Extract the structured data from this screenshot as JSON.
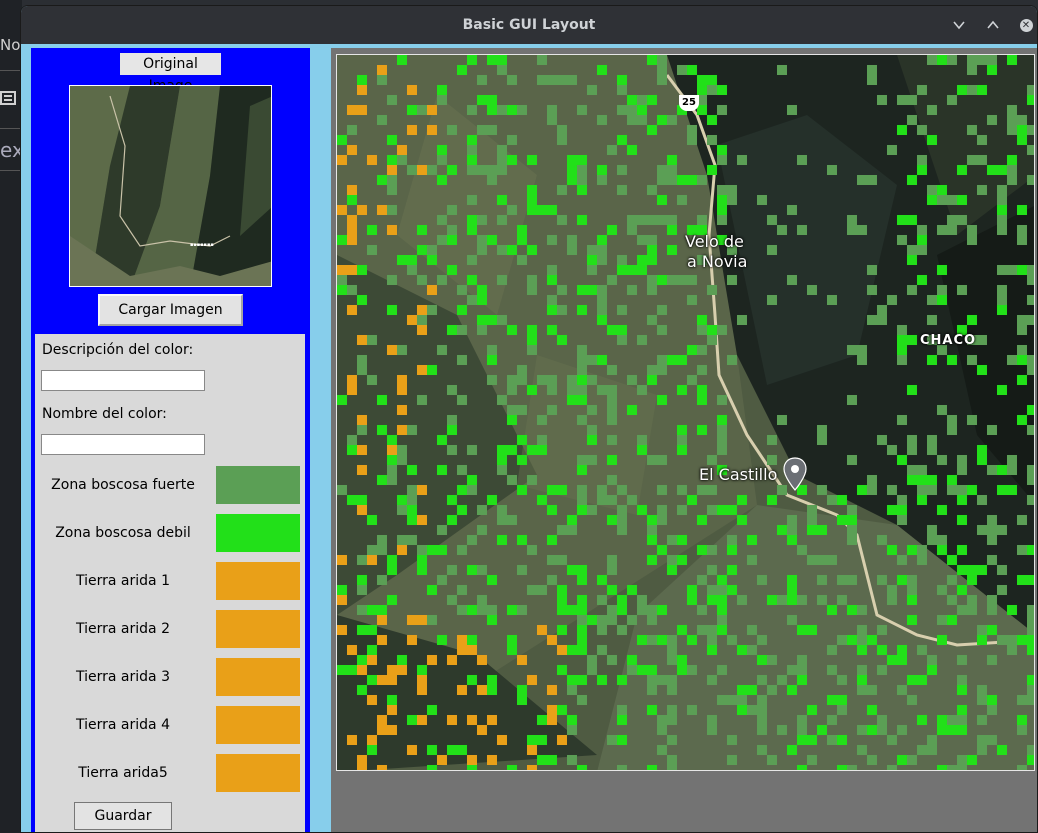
{
  "window": {
    "title": "Basic GUI Layout",
    "controls": {
      "minimize": "⌄",
      "maximize": "⌃",
      "close": "✕"
    }
  },
  "background": {
    "tab_text": "Note",
    "text": "ex"
  },
  "left_panel": {
    "original_label": "Original Image",
    "load_button": "Cargar Imagen",
    "form": {
      "description_label": "Descripción del color:",
      "description_value": "",
      "name_label": "Nombre del color:",
      "name_value": ""
    },
    "legend": [
      {
        "name": "Zona boscosa fuerte",
        "color": "#5b9f55"
      },
      {
        "name": "Zona boscosa debil",
        "color": "#22e019"
      },
      {
        "name": "Tierra arida 1",
        "color": "#e9a018"
      },
      {
        "name": "Tierra arida 2",
        "color": "#e9a018"
      },
      {
        "name": "Tierra arida 3",
        "color": "#e9a018"
      },
      {
        "name": "Tierra arida 4",
        "color": "#e9a018"
      },
      {
        "name": "Tierra arida5",
        "color": "#e9a018"
      }
    ],
    "save_button": "Guardar"
  },
  "map": {
    "labels": {
      "velo_line1": "Velo de",
      "velo_line2": "a Novia",
      "chaco": "CHACO",
      "castillo": "El Castillo",
      "route": "25"
    },
    "icons": [
      "map-pin-icon",
      "route-shield-icon"
    ]
  },
  "colors": {
    "panel_blue": "#0000ff",
    "window_bg": "#87ceeb",
    "strong_forest": "#5b9f55",
    "weak_forest": "#22e019",
    "arid": "#e9a018"
  }
}
